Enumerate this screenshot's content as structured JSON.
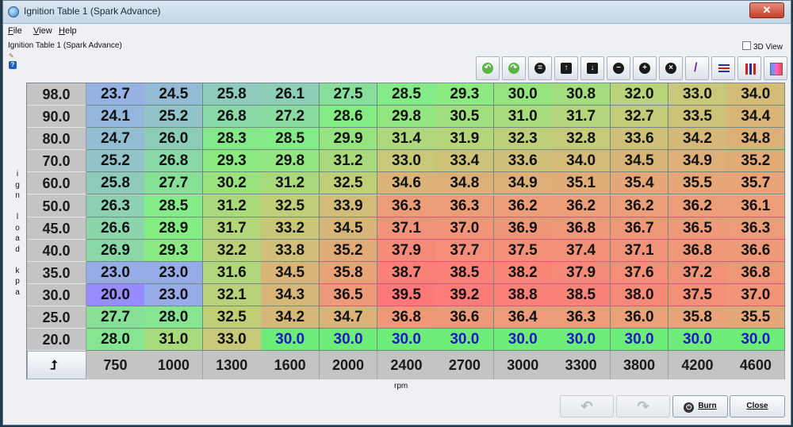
{
  "window": {
    "title": "Ignition Table 1 (Spark Advance)",
    "close_glyph": "✕"
  },
  "menu": [
    {
      "label": "File"
    },
    {
      "label": "View"
    },
    {
      "label": "Help"
    }
  ],
  "panel": {
    "title": "Ignition Table 1 (Spark Advance)",
    "view3d_label": "3D View",
    "view3d_checked": false
  },
  "toolbar": [
    {
      "name": "rotate-left-icon",
      "glyph": "↶"
    },
    {
      "name": "rotate-right-icon",
      "glyph": "↷"
    },
    {
      "name": "equals-icon",
      "glyph": "="
    },
    {
      "name": "arrow-up-icon",
      "glyph": "↑"
    },
    {
      "name": "arrow-down-icon",
      "glyph": "↓"
    },
    {
      "name": "minus-icon",
      "glyph": "−"
    },
    {
      "name": "plus-icon",
      "glyph": "+"
    },
    {
      "name": "multiply-icon",
      "glyph": "×"
    },
    {
      "name": "pencil-icon",
      "glyph": "/"
    },
    {
      "name": "horizontal-interpolate-icon",
      "glyph": ""
    },
    {
      "name": "vertical-interpolate-icon",
      "glyph": ""
    },
    {
      "name": "color-gradient-icon",
      "glyph": ""
    }
  ],
  "table": {
    "y_axis_title": "ign load kpa",
    "x_axis_title": "rpm",
    "corner_glyph": "⮥",
    "y_values": [
      "98.0",
      "90.0",
      "80.0",
      "70.0",
      "60.0",
      "50.0",
      "45.0",
      "40.0",
      "35.0",
      "30.0",
      "25.0",
      "20.0"
    ],
    "x_values": [
      "750",
      "1000",
      "1300",
      "1600",
      "2000",
      "2400",
      "2700",
      "3000",
      "3300",
      "3800",
      "4200",
      "4600"
    ],
    "rows": [
      [
        "23.7",
        "24.5",
        "25.8",
        "26.1",
        "27.5",
        "28.5",
        "29.3",
        "30.0",
        "30.8",
        "32.0",
        "33.0",
        "34.0"
      ],
      [
        "24.1",
        "25.2",
        "26.8",
        "27.2",
        "28.6",
        "29.8",
        "30.5",
        "31.0",
        "31.7",
        "32.7",
        "33.5",
        "34.4"
      ],
      [
        "24.7",
        "26.0",
        "28.3",
        "28.5",
        "29.9",
        "31.4",
        "31.9",
        "32.3",
        "32.8",
        "33.6",
        "34.2",
        "34.8"
      ],
      [
        "25.2",
        "26.8",
        "29.3",
        "29.8",
        "31.2",
        "33.0",
        "33.4",
        "33.6",
        "34.0",
        "34.5",
        "34.9",
        "35.2"
      ],
      [
        "25.8",
        "27.7",
        "30.2",
        "31.2",
        "32.5",
        "34.6",
        "34.8",
        "34.9",
        "35.1",
        "35.4",
        "35.5",
        "35.7"
      ],
      [
        "26.3",
        "28.5",
        "31.2",
        "32.5",
        "33.9",
        "36.3",
        "36.3",
        "36.2",
        "36.2",
        "36.2",
        "36.2",
        "36.1"
      ],
      [
        "26.6",
        "28.9",
        "31.7",
        "33.2",
        "34.5",
        "37.1",
        "37.0",
        "36.9",
        "36.8",
        "36.7",
        "36.5",
        "36.3"
      ],
      [
        "26.9",
        "29.3",
        "32.2",
        "33.8",
        "35.2",
        "37.9",
        "37.7",
        "37.5",
        "37.4",
        "37.1",
        "36.8",
        "36.6"
      ],
      [
        "23.0",
        "23.0",
        "31.6",
        "34.5",
        "35.8",
        "38.7",
        "38.5",
        "38.2",
        "37.9",
        "37.6",
        "37.2",
        "36.8"
      ],
      [
        "20.0",
        "23.0",
        "32.1",
        "34.3",
        "36.5",
        "39.5",
        "39.2",
        "38.8",
        "38.5",
        "38.0",
        "37.5",
        "37.0"
      ],
      [
        "27.7",
        "28.0",
        "32.5",
        "34.2",
        "34.7",
        "36.8",
        "36.6",
        "36.4",
        "36.3",
        "36.0",
        "35.8",
        "35.5"
      ],
      [
        "28.0",
        "31.0",
        "33.0",
        "30.0",
        "30.0",
        "30.0",
        "30.0",
        "30.0",
        "30.0",
        "30.0",
        "30.0",
        "30.0"
      ]
    ],
    "blue_text_color": "#1d17c4"
  },
  "buttons": {
    "undo_glyph": "↶",
    "redo_glyph": "↷",
    "burn_label": "Burn",
    "close_label": "Close"
  },
  "colors": {
    "accent": "#3a7fc4",
    "close_red": "#c4402a"
  }
}
